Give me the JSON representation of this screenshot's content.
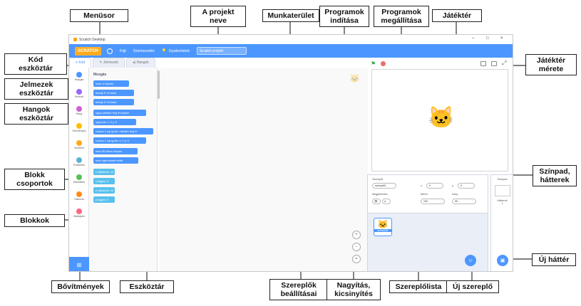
{
  "callouts": {
    "menusor": "Menüsor",
    "projekt_neve": "A projekt\nneve",
    "munkaterulet": "Munkaterület",
    "programok_inditasa": "Programok\nindítása",
    "programok_megallitasa": "Programok\nmegállítása",
    "jatekter": "Játéktér",
    "kod_eszkoztar": "Kód\neszköztár",
    "jelmezek_eszkoztar": "Jelmezek\neszköztár",
    "hangok_eszkoztar": "Hangok\neszköztár",
    "jatekter_merete": "Játéktér\nmérete",
    "blokk_csoportok": "Blokk\ncsoportok",
    "szinpad_hatterek": "Színpad,\nhátterek",
    "blokkok": "Blokkok",
    "uj_hatter": "Új háttér",
    "bovitmenyek": "Bővítmények",
    "eszkoztar": "Eszköztár",
    "szereplok_beallitasai": "Szereplők\nbeállításai",
    "nagyitas_kicsinyites": "Nagyítás,\nkicsinyítés",
    "szereplolista": "Szereplőlista",
    "uj_szereplo": "Új szereplő"
  },
  "window": {
    "title": "Scratch Desktop",
    "controls": [
      "–",
      "□",
      "×"
    ]
  },
  "menubar": {
    "logo": "SCRATCH",
    "file": "Fájl",
    "edit": "Szerkesztés",
    "tutorials": "Gyakorlatok",
    "project_name": "Scratch projekt"
  },
  "tabs": [
    "Kód",
    "Jelmezek",
    "Hangok"
  ],
  "categories": [
    {
      "label": "Mozgás",
      "color": "#4c97ff"
    },
    {
      "label": "Kinézet",
      "color": "#9966ff"
    },
    {
      "label": "Hang",
      "color": "#cf63cf"
    },
    {
      "label": "Események",
      "color": "#ffbf00"
    },
    {
      "label": "Vezérlés",
      "color": "#ffab19"
    },
    {
      "label": "Érzékelés",
      "color": "#5cb1d6"
    },
    {
      "label": "Műveletek",
      "color": "#59c059"
    },
    {
      "label": "Változók",
      "color": "#ff8c1a"
    },
    {
      "label": "Blokkjaim",
      "color": "#ff6680"
    }
  ],
  "palette": {
    "heading": "Mozgás",
    "blocks": [
      {
        "text": "menj 10 lépést",
        "kind": "motion"
      },
      {
        "text": "fordulj ↻ 15 fokot",
        "kind": "motion"
      },
      {
        "text": "fordulj ↺ 15 fokot",
        "kind": "motion"
      },
      {
        "text": "ugorj véletlen hely ▾ helyére",
        "kind": "motion"
      },
      {
        "text": "ugorj ide: x: 0 y: 0",
        "kind": "motion"
      },
      {
        "text": "csússz 1 mp-ig ide: véletlen hely ▾",
        "kind": "motion"
      },
      {
        "text": "csússz 1 mp-ig ide: x: 0 y: 0",
        "kind": "motion"
      },
      {
        "text": "nézz 90 fokos irányba",
        "kind": "motion"
      },
      {
        "text": "nézz egérmutató ▾ felé",
        "kind": "motion"
      },
      {
        "text": "x változzon: 10",
        "kind": "var"
      },
      {
        "text": "x legyen: 0",
        "kind": "var"
      },
      {
        "text": "y változzon: 10",
        "kind": "var"
      },
      {
        "text": "y legyen: 0",
        "kind": "var"
      }
    ]
  },
  "zoom_buttons": [
    "+",
    "−",
    "="
  ],
  "sprite_info": {
    "sprite_label": "Szereplő",
    "sprite_name": "szereplő1",
    "x_label": "x",
    "x_value": "0",
    "y_label": "y",
    "y_value": "0",
    "show_label": "Megjelenítés",
    "size_label": "Méret",
    "size_value": "100",
    "direction_label": "Irány",
    "direction_value": "90"
  },
  "sprite_list": [
    {
      "name": "szereplő1"
    }
  ],
  "stage_pane": {
    "title": "Színpad",
    "backdrops_label": "Hátterek",
    "backdrops_count": "1"
  },
  "colors": {
    "accent": "#4c97ff",
    "flag": "#2eae48",
    "stop": "#e8706e"
  },
  "icons": [
    "green-flag-icon",
    "stop-icon",
    "cat-sprite-icon",
    "extension-icon",
    "new-sprite-icon",
    "new-backdrop-icon"
  ]
}
